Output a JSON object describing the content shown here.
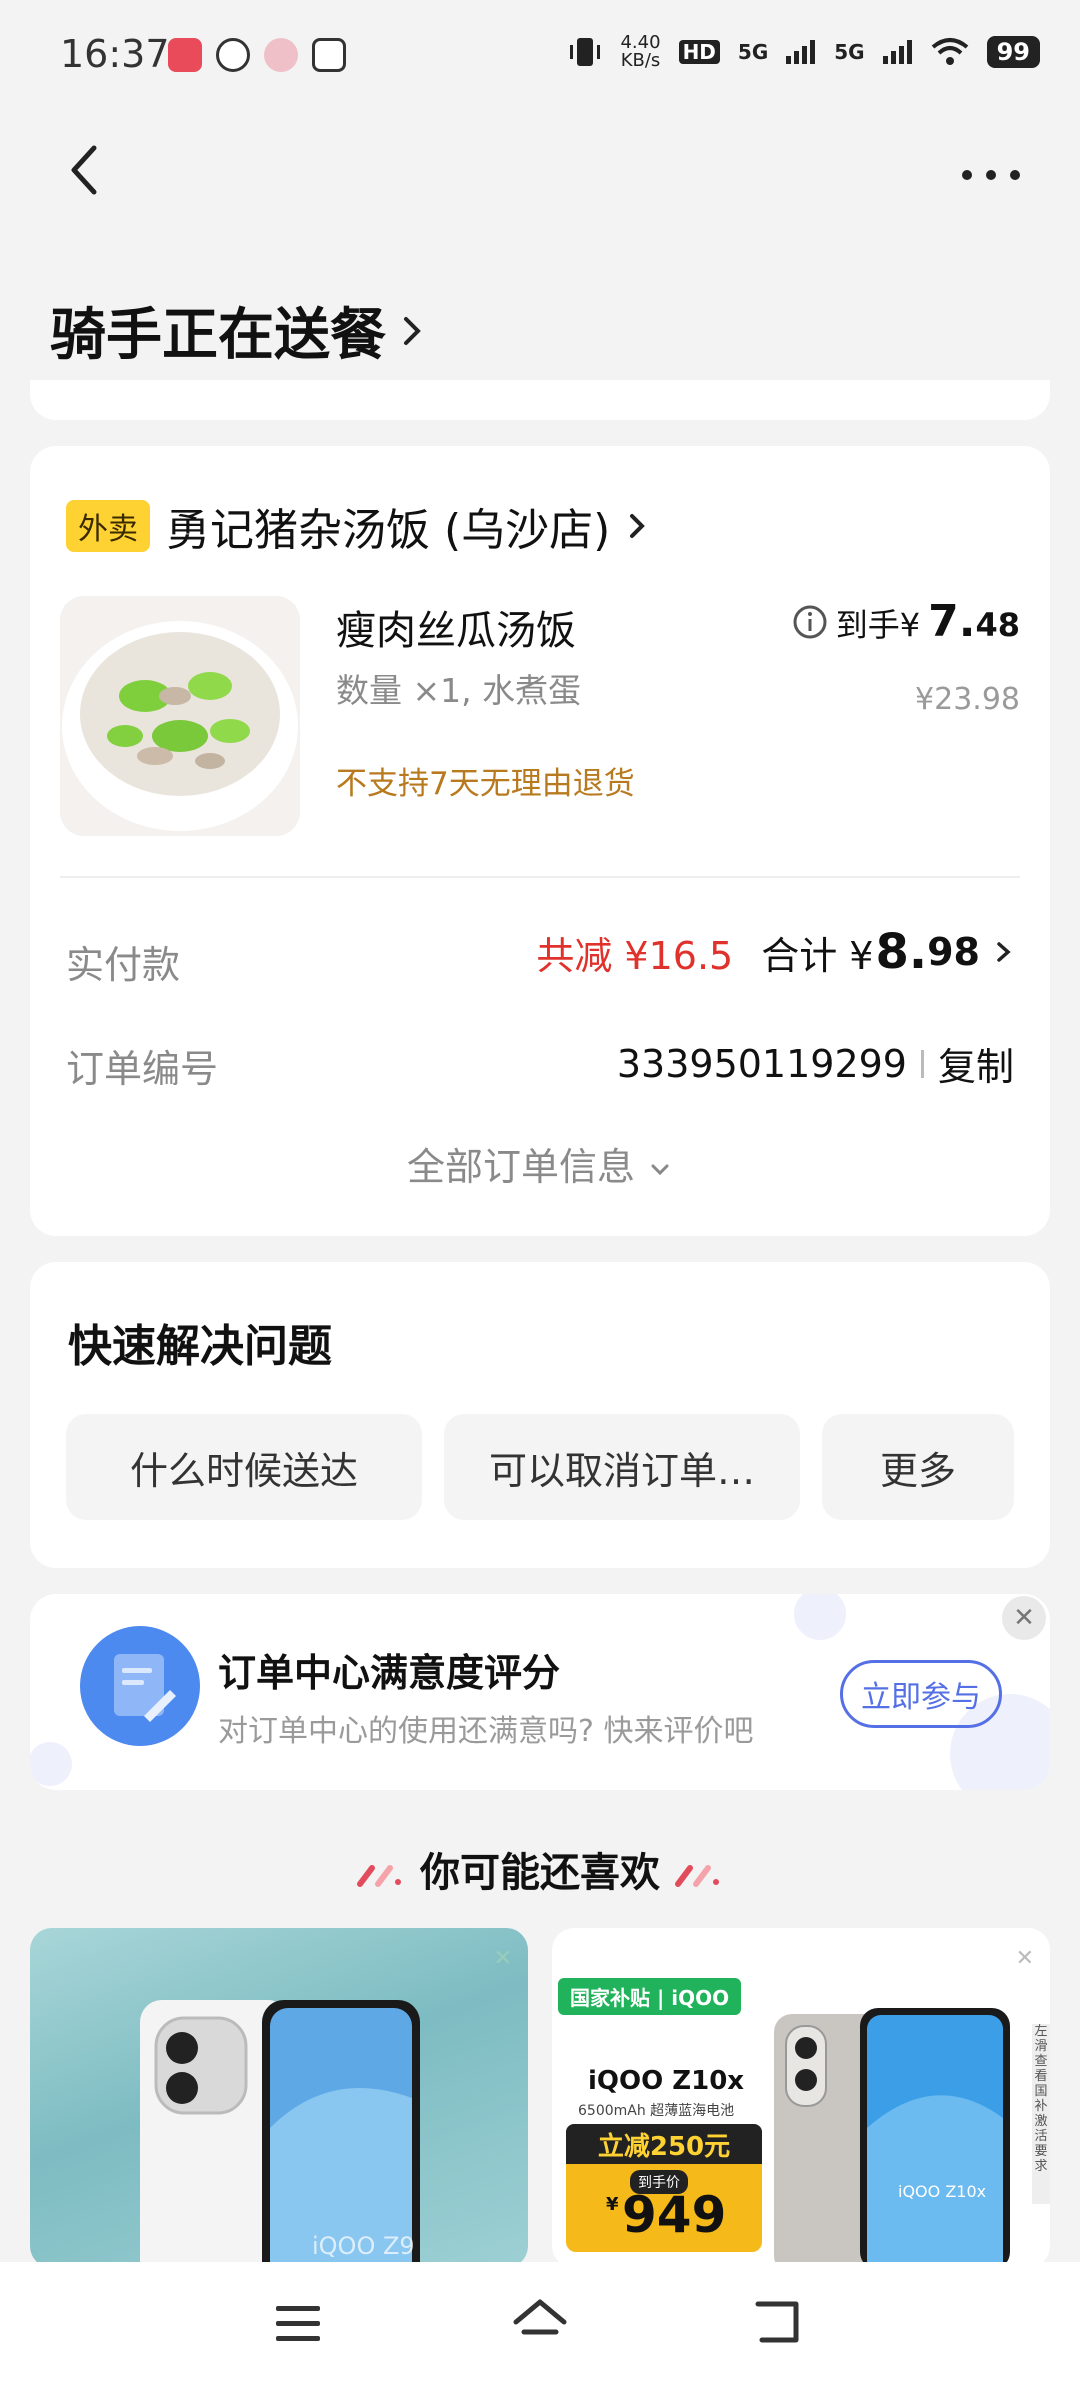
{
  "status_bar": {
    "time": "16:37",
    "net_speed_value": "4.40",
    "net_speed_unit": "KB/s",
    "hd_label": "HD",
    "signal1": "5G",
    "signal2": "5G",
    "battery": "99"
  },
  "header": {
    "title": "骑手正在送餐",
    "title_chevron": "›"
  },
  "order": {
    "tag": "外卖",
    "shop_name": "勇记猪杂汤饭 (乌沙店)",
    "item_name": "瘦肉丝瓜汤饭",
    "item_spec": "数量 ×1, 水煮蛋",
    "item_note": "不支持7天无理由退货",
    "price_prefix": "到手¥",
    "price_int": "7.",
    "price_dec": "48",
    "original_price": "¥23.98",
    "paid_label": "实付款",
    "discount_text": "共减 ¥16.5",
    "total_prefix": "合计 ¥",
    "total_int": "8.",
    "total_dec": "98",
    "order_no_label": "订单编号",
    "order_no": "333950119299",
    "copy_label": "复制",
    "all_info_label": "全部订单信息"
  },
  "quick_help": {
    "title": "快速解决问题",
    "buttons": [
      "什么时候送达",
      "可以取消订单…",
      "更多"
    ]
  },
  "survey": {
    "title": "订单中心满意度评分",
    "subtitle": "对订单中心的使用还满意吗? 快来评价吧",
    "button": "立即参与",
    "close": "✕"
  },
  "recommend": {
    "title": "你可能还喜欢",
    "ad1": {
      "brand": "iQOO Z9",
      "close": "✕"
    },
    "ad2": {
      "badge": "国家补贴 | iQOO",
      "model": "iQOO Z10x",
      "battery_note": "6500mAh 超薄蓝海电池",
      "discount": "立减250元",
      "final_label": "到手价",
      "price": "949",
      "price_symbol": "¥",
      "screen_brand": "iQOO Z10x",
      "side_text": "左滑查看国补激活要求",
      "close": "✕"
    }
  },
  "colors": {
    "accent_red": "#e0322c",
    "tag_yellow": "#ffd233",
    "survey_blue": "#5570e5",
    "note_brown": "#b87a1e"
  }
}
